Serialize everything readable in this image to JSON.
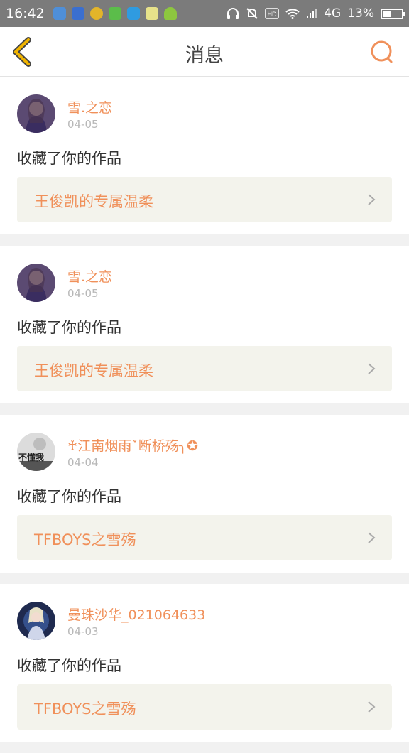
{
  "status_bar": {
    "time": "16:42",
    "network": "4G",
    "battery_percent": "13%",
    "battery_level": 0.13,
    "notification_icons": [
      "lock-app-icon",
      "baidu-icon",
      "game-icon",
      "store-icon",
      "scan-icon",
      "face-app-icon",
      "android-icon"
    ],
    "system_icons": [
      "headphones-icon",
      "mute-bell-icon",
      "hd-icon",
      "wifi-icon",
      "signal-icon"
    ]
  },
  "header": {
    "title": "消息",
    "back_icon": "back-chevron-icon",
    "search_icon": "search-icon"
  },
  "colors": {
    "accent": "#f0905a",
    "back_accent": "#f0b400",
    "status_bar": "#7b7b7b",
    "card_box": "#f3f3ec"
  },
  "messages": [
    {
      "username": "雪.之恋",
      "date": "04-05",
      "action": "收藏了你的作品",
      "work_title": "王俊凯的专属温柔",
      "avatar": "avatar-girl-purple"
    },
    {
      "username": "雪.之恋",
      "date": "04-05",
      "action": "收藏了你的作品",
      "work_title": "王俊凯的专属温柔",
      "avatar": "avatar-girl-purple"
    },
    {
      "username": "♰江南烟雨ˇ断桥殇╮✪",
      "date": "04-04",
      "action": "收藏了你的作品",
      "work_title": "TFBOYS之雪殇",
      "avatar": "avatar-bu-dong-wo",
      "avatar_text": "不懂我"
    },
    {
      "username": "曼珠沙华_021064633",
      "date": "04-03",
      "action": "收藏了你的作品",
      "work_title": "TFBOYS之雪殇",
      "avatar": "avatar-anime-girl"
    }
  ]
}
